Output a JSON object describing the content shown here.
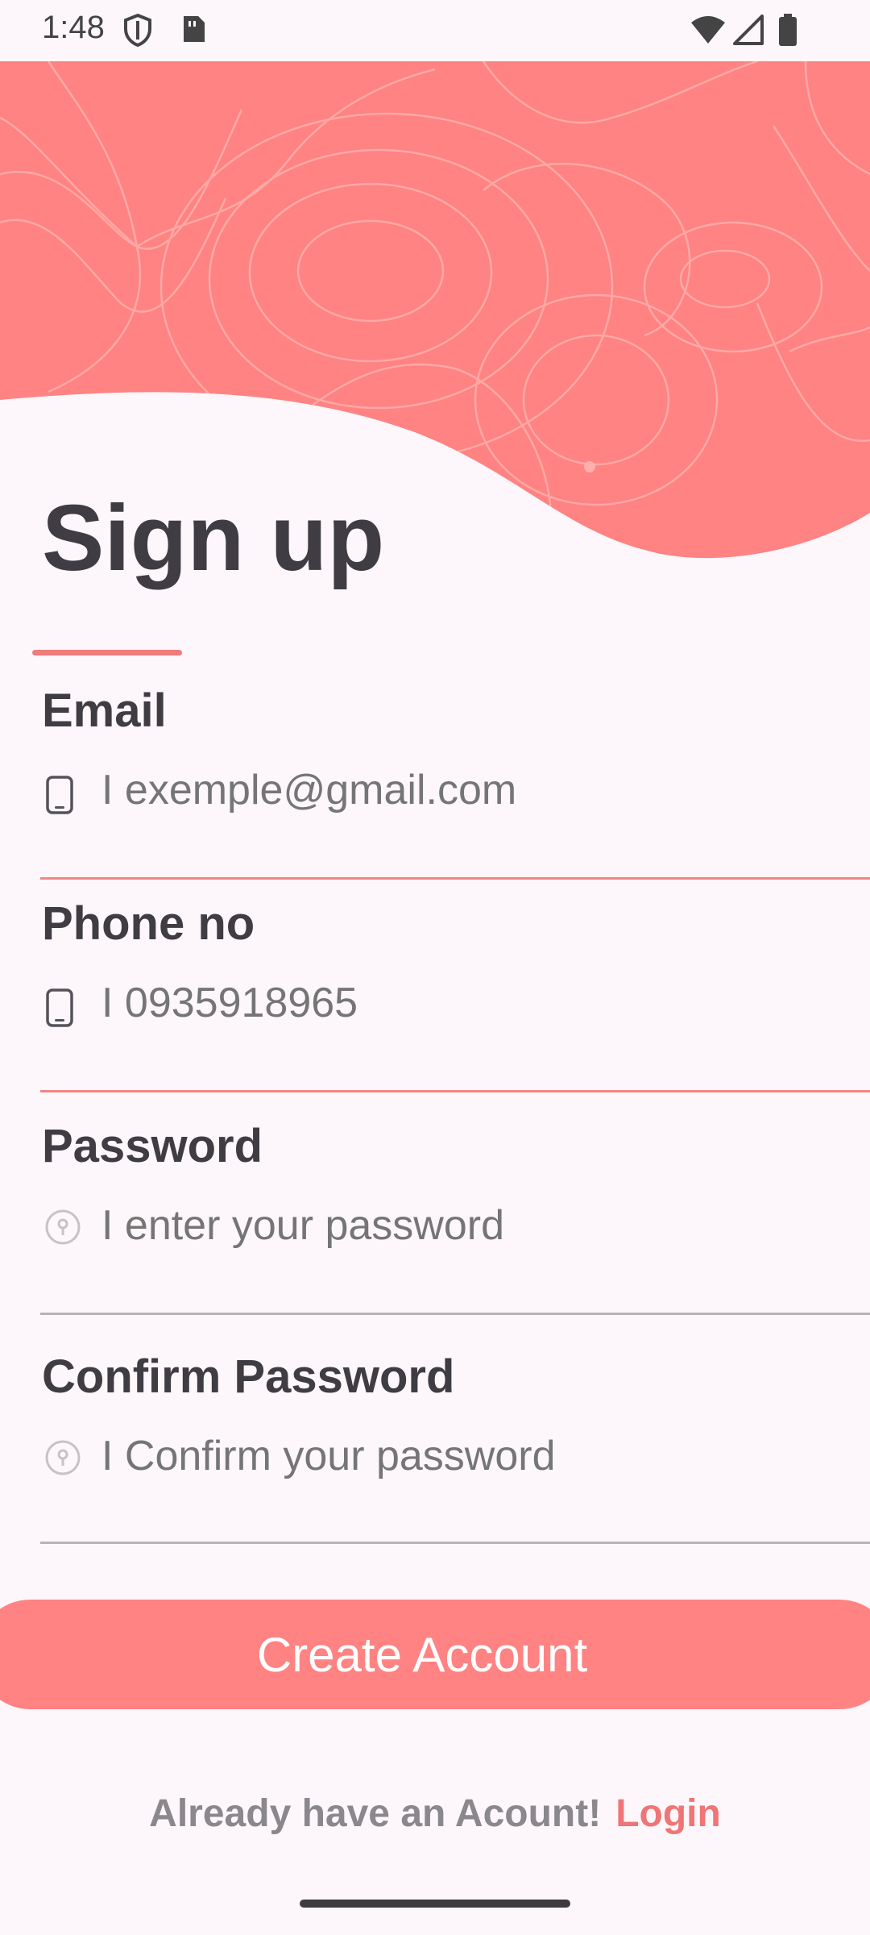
{
  "status_bar": {
    "time": "1:48"
  },
  "title": "Sign up",
  "colors": {
    "accent": "#ff8382",
    "link": "#ef7576",
    "background": "#fdf7fb"
  },
  "form": {
    "email": {
      "label": "Email",
      "placeholder": "I exemple@gmail.com",
      "icon": "phone-icon"
    },
    "phone": {
      "label": "Phone no",
      "placeholder": "I 0935918965",
      "icon": "phone-icon"
    },
    "password": {
      "label": "Password",
      "placeholder": "I enter your password",
      "icon": "key-icon"
    },
    "confirm_password": {
      "label": "Confirm Password",
      "placeholder": "I Confirm your password",
      "icon": "key-icon"
    }
  },
  "create_button": "Create Account",
  "footer": {
    "text": "Already have an Acount!",
    "link": "Login"
  }
}
